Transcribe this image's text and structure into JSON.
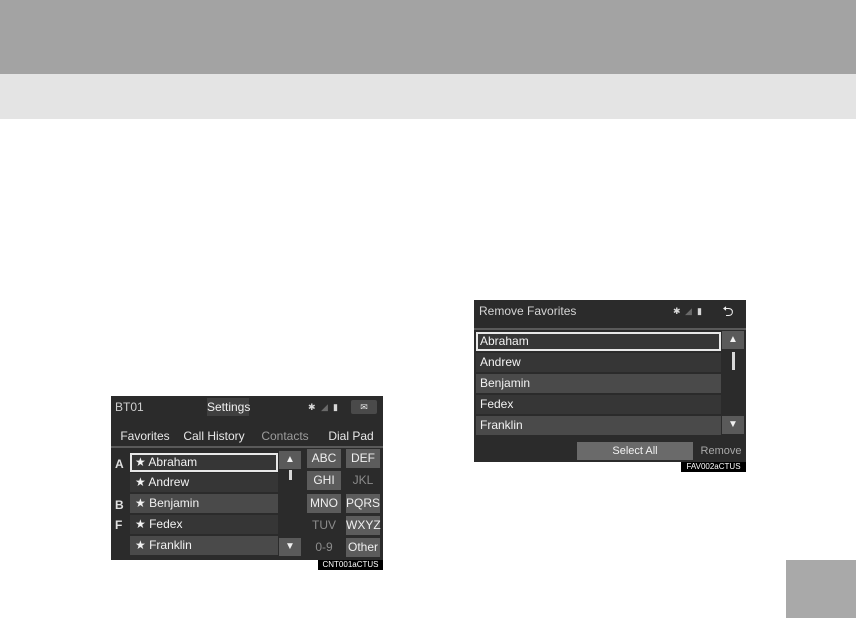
{
  "screen1": {
    "device": "BT01",
    "settings_label": "Settings",
    "tabs": [
      "Favorites",
      "Call History",
      "Contacts",
      "Dial Pad"
    ],
    "index_letters": [
      "A",
      "B",
      "F"
    ],
    "contacts": [
      "★ Abraham",
      "★ Andrew",
      "★ Benjamin",
      "★ Fedex",
      "★ Franklin"
    ],
    "keys": [
      "ABC",
      "DEF",
      "GHI",
      "JKL",
      "MNO",
      "PQRS",
      "TUV",
      "WXYZ",
      "0-9",
      "Other"
    ],
    "scroll_up": "▲",
    "scroll_down": "▼",
    "caption": "CNT001aCTUS"
  },
  "screen2": {
    "title": "Remove Favorites",
    "favorites": [
      "Abraham",
      "Andrew",
      "Benjamin",
      "Fedex",
      "Franklin"
    ],
    "select_all": "Select All",
    "remove": "Remove",
    "back": "⮌",
    "scroll_up": "▲",
    "scroll_down": "▼",
    "caption": "FAV002aCTUS"
  },
  "status": {
    "bluetooth": "✱",
    "signal": "◢",
    "battery": "▮",
    "message": "✉"
  }
}
